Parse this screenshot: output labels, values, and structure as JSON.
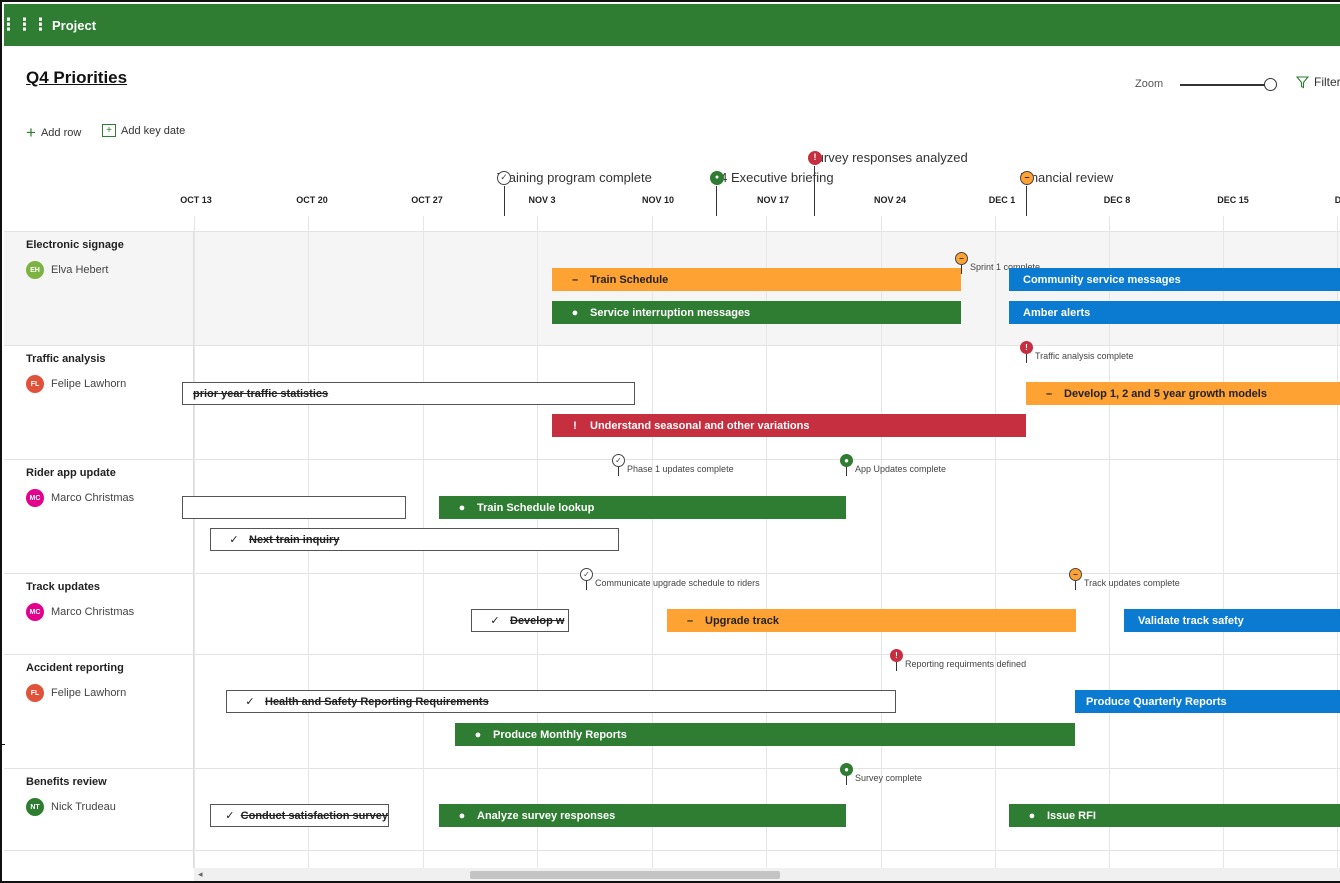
{
  "app": {
    "name": "Project",
    "waffle_icon": "app-launcher-icon"
  },
  "page": {
    "title": "Q4 Priorities"
  },
  "toolbar": {
    "add_row": "Add row",
    "add_key_date": "Add key date",
    "zoom_label": "Zoom",
    "zoom_level": 0.95,
    "filter": "Filter"
  },
  "key_dates": [
    {
      "label": "Training program complete",
      "status": "complete"
    },
    {
      "label": "Q4 Executive briefing",
      "status": "on-track"
    },
    {
      "label": "Survey responses analyzed",
      "status": "at-risk"
    },
    {
      "label": "Financial review",
      "status": "behind"
    }
  ],
  "timeline": {
    "dates": [
      "OCT 13",
      "OCT 20",
      "OCT 27",
      "NOV 3",
      "NOV 10",
      "NOV 17",
      "NOV 24",
      "DEC 1",
      "DEC 8",
      "DEC 15",
      "D"
    ]
  },
  "rows": [
    {
      "title": "Electronic signage",
      "owner": "Elva Hebert",
      "initials": "EH",
      "avatar_color": "#7cb342",
      "milestones": [
        {
          "label": "Sprint 1 complete",
          "status": "behind"
        }
      ],
      "bars": [
        {
          "label": "Train Schedule",
          "symbol": "–",
          "status": "behind"
        },
        {
          "label": "Service interruption messages",
          "symbol": "●",
          "status": "on-track"
        },
        {
          "label": "Community service messages",
          "symbol": "",
          "status": "not-started"
        },
        {
          "label": "Amber alerts",
          "symbol": "",
          "status": "not-started"
        }
      ]
    },
    {
      "title": "Traffic analysis",
      "owner": "Felipe Lawhorn",
      "initials": "FL",
      "avatar_color": "#e0533a",
      "milestones": [
        {
          "label": "Traffic analysis complete",
          "status": "at-risk"
        }
      ],
      "bars": [
        {
          "label": "prior year traffic statistics",
          "symbol": "",
          "status": "complete"
        },
        {
          "label": "Develop 1, 2 and 5 year growth models",
          "symbol": "–",
          "status": "behind"
        },
        {
          "label": "Understand seasonal and other variations",
          "symbol": "!",
          "status": "at-risk"
        }
      ]
    },
    {
      "title": "Rider app update",
      "owner": "Marco Christmas",
      "initials": "MC",
      "avatar_color": "#e3008c",
      "milestones": [
        {
          "label": "Phase 1 updates complete",
          "status": "complete"
        },
        {
          "label": "App Updates complete",
          "status": "on-track"
        }
      ],
      "bars": [
        {
          "label": "",
          "symbol": "",
          "status": "complete"
        },
        {
          "label": "Train Schedule lookup",
          "symbol": "●",
          "status": "on-track"
        },
        {
          "label": "Next train inquiry",
          "symbol": "✓",
          "status": "complete"
        }
      ]
    },
    {
      "title": "Track updates",
      "owner": "Marco Christmas",
      "initials": "MC",
      "avatar_color": "#e3008c",
      "milestones": [
        {
          "label": "Communicate upgrade schedule to riders",
          "status": "complete"
        },
        {
          "label": "Track updates complete",
          "status": "behind"
        }
      ],
      "bars": [
        {
          "label": "Develop w",
          "symbol": "✓",
          "status": "complete"
        },
        {
          "label": "Upgrade track",
          "symbol": "–",
          "status": "behind"
        },
        {
          "label": "Validate track safety",
          "symbol": "",
          "status": "not-started"
        }
      ]
    },
    {
      "title": "Accident reporting",
      "owner": "Felipe Lawhorn",
      "initials": "FL",
      "avatar_color": "#e0533a",
      "milestones": [
        {
          "label": "Reporting requirments defined",
          "status": "at-risk"
        }
      ],
      "bars": [
        {
          "label": "Health and Safety Reporting Requirements",
          "symbol": "✓",
          "status": "complete"
        },
        {
          "label": "Produce Quarterly Reports",
          "symbol": "",
          "status": "not-started"
        },
        {
          "label": "Produce Monthly Reports",
          "symbol": "●",
          "status": "on-track"
        }
      ]
    },
    {
      "title": "Benefits review",
      "owner": "Nick Trudeau",
      "initials": "NT",
      "avatar_color": "#2e7d32",
      "milestones": [
        {
          "label": "Survey complete",
          "status": "on-track"
        }
      ],
      "bars": [
        {
          "label": "Conduct satisfaction survey",
          "symbol": "✓",
          "status": "complete"
        },
        {
          "label": "Analyze survey responses",
          "symbol": "●",
          "status": "on-track"
        },
        {
          "label": "Issue RFI",
          "symbol": "●",
          "status": "on-track"
        }
      ]
    }
  ],
  "colors": {
    "brand": "#2e7d32",
    "on_track": "#2e7d32",
    "behind": "#ffa234",
    "at_risk": "#c62f3f",
    "not_started": "#0b7ad1"
  }
}
